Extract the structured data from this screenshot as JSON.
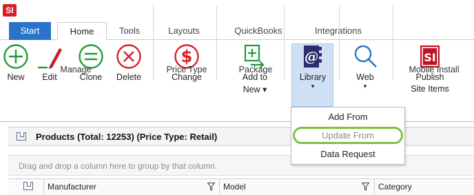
{
  "app": {
    "logo_text": "SI"
  },
  "tabs": [
    {
      "label": "Start"
    },
    {
      "label": "Home"
    },
    {
      "label": "Tools"
    },
    {
      "label": "Layouts"
    },
    {
      "label": "QuickBooks"
    },
    {
      "label": "Integrations"
    }
  ],
  "ribbon": {
    "manage": {
      "label": "Manage",
      "new": "New",
      "edit": "Edit",
      "clone": "Clone",
      "delete": "Delete"
    },
    "price_type": {
      "label": "Price Type",
      "change": "Change"
    },
    "package": {
      "label": "Package",
      "add_line1": "Add to",
      "add_line2": "New ▾"
    },
    "library": {
      "label": "Library",
      "caret": "▾"
    },
    "web": {
      "label": "Web",
      "caret": "▾"
    },
    "mobile": {
      "label": "Mobile Install",
      "publish_line1": "Publish",
      "publish_line2": "Site Items"
    }
  },
  "library_menu": {
    "items": [
      {
        "label": "Add From",
        "enabled": true
      },
      {
        "label": "Update From",
        "enabled": false
      },
      {
        "label": "Data Request",
        "enabled": true
      }
    ]
  },
  "products": {
    "title": "Products (Total: 12253) (Price Type: Retail)",
    "group_hint": "Drag and drop a column here to group by that column.",
    "columns": [
      "Manufacturer",
      "Model",
      "Category"
    ]
  },
  "colors": {
    "accent_blue": "#2b73c8",
    "new_green": "#1e9b3a",
    "delete_red": "#d71f26",
    "highlight_ring": "#7cc142"
  }
}
